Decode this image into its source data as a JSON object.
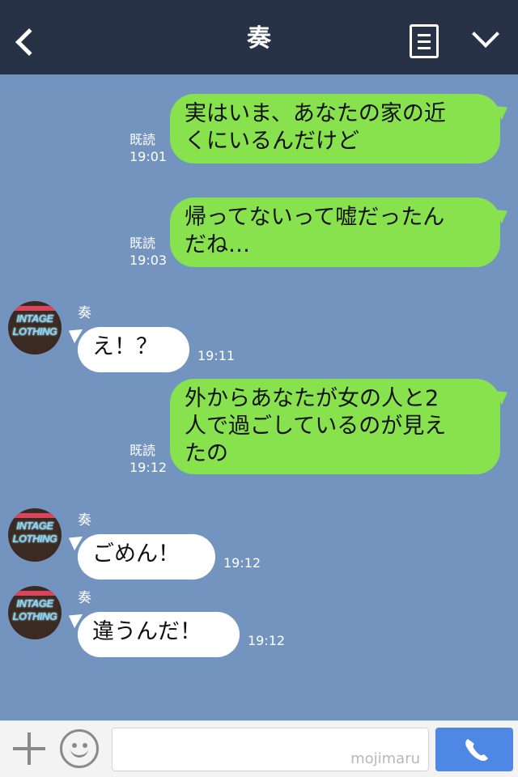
{
  "header": {
    "title": "奏"
  },
  "messages": [
    {
      "type": "out",
      "lines": [
        "実はいま、あなたの家の近",
        "くにいるんだけど"
      ],
      "read": "既読",
      "time": "19:01"
    },
    {
      "type": "out",
      "lines": [
        "帰ってないって嘘だったん",
        "だね…"
      ],
      "read": "既読",
      "time": "19:03"
    },
    {
      "type": "in",
      "sender": "奏",
      "text": "え！？",
      "time": "19:11"
    },
    {
      "type": "out",
      "lines": [
        "外からあなたが女の人と2",
        "人で過ごしているのが見え",
        "たの"
      ],
      "read": "既読",
      "time": "19:12"
    },
    {
      "type": "in",
      "sender": "奏",
      "text": "ごめん！",
      "time": "19:12"
    },
    {
      "type": "in",
      "sender": "奏",
      "text": "違うんだ！",
      "time": "19:12"
    }
  ],
  "avatar": {
    "line1": "INTAGE",
    "line2": "LOTHING"
  },
  "input": {
    "watermark": "mojimaru"
  },
  "icons": {
    "back": "chevron-left-icon",
    "memo": "note-icon",
    "menu": "chevron-down-icon",
    "plus": "plus-icon",
    "emoji": "smiley-icon",
    "call": "phone-icon"
  },
  "colors": {
    "header_bg": "#273246",
    "chat_bg": "#7494c0",
    "out_bubble": "#87e24e",
    "in_bubble": "#ffffff",
    "call_button": "#4f88e4"
  }
}
